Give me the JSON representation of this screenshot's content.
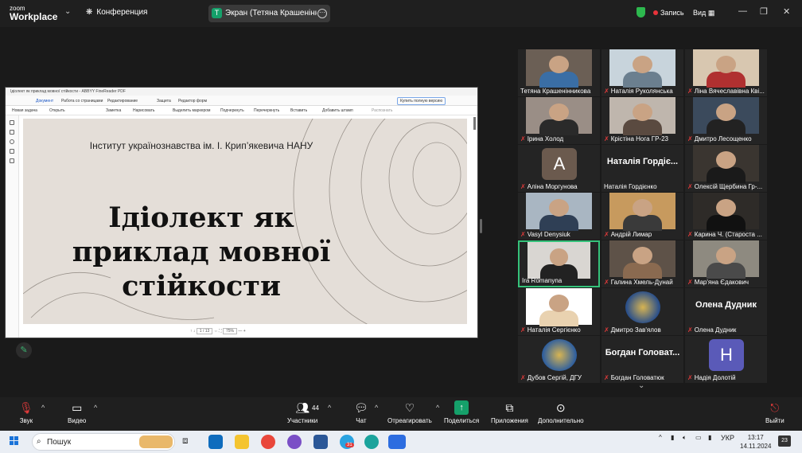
{
  "topbar": {
    "brand_small": "zoom",
    "brand_big": "Workplace",
    "conference": "Конференция",
    "share_initial": "T",
    "share_label": "Экран (Тетяна Крашенінникова",
    "record_label": "Запись",
    "view_label": "Вид"
  },
  "shared_window": {
    "title": "Ідіолект як приклад мовної стійкости - ABBYY FineReader PDF",
    "menu": [
      "Документ",
      "Работа со страницами",
      "Редактирование",
      "Защита",
      "Редактор форм"
    ],
    "buy_label": "Купить полную версию",
    "tools": [
      "Новая задача",
      "Открыть",
      "Заметка",
      "Нарисовать",
      "Выделить маркером",
      "Подчеркнуть",
      "Перечеркнуть",
      "Вставить",
      "Добавить штамп",
      "Распознать"
    ],
    "page_indicator": "1 / 13",
    "zoom": "75%"
  },
  "slide": {
    "institute": "Інститут українознавства ім. І. Крип’якевича НАНУ",
    "title_line1": "Ідіолект як",
    "title_line2": "приклад мовної",
    "title_line3": "стійкости"
  },
  "participants": [
    {
      "name": "Тетяна Крашенінникова",
      "muted": false,
      "kind": "photo",
      "bg": "#6b5f55",
      "shirt": "#3a6ea5"
    },
    {
      "name": "Наталія Руколянська",
      "muted": true,
      "kind": "photo",
      "bg": "#c8d4dc",
      "shirt": "#6b7f8f"
    },
    {
      "name": "Ліна Вячеславівна Кві...",
      "muted": true,
      "kind": "photo",
      "bg": "#d8c7b0",
      "shirt": "#b03030"
    },
    {
      "name": "Ірина Холод",
      "muted": true,
      "kind": "photo",
      "bg": "#9a8e86",
      "shirt": "#2a2a2a"
    },
    {
      "name": "Крістіна Нога ГР-23",
      "muted": true,
      "kind": "photo",
      "bg": "#bfb6ad",
      "shirt": "#5a4a40"
    },
    {
      "name": "Дмитро Лесощенко",
      "muted": true,
      "kind": "photo",
      "bg": "#3b4a5c",
      "shirt": "#222"
    },
    {
      "name": "Аліна Моргунова",
      "muted": true,
      "kind": "letter",
      "letter": "A",
      "color": "#6b5a4e"
    },
    {
      "name": "Наталія Гордієнко",
      "muted": false,
      "kind": "bigname",
      "big": "Наталія Гордіє..."
    },
    {
      "name": "Олексій Щербина Гр-...",
      "muted": true,
      "kind": "photo",
      "bg": "#3a3530",
      "shirt": "#1a1a1a"
    },
    {
      "name": "Vasyl Denysiuk",
      "muted": true,
      "kind": "photo",
      "bg": "#a9b6c2",
      "shirt": "#2f3f55"
    },
    {
      "name": "Андрій Лимар",
      "muted": true,
      "kind": "photo",
      "bg": "#c79a5e",
      "shirt": "#3a3a3a"
    },
    {
      "name": "Карина Ч. (Староста ...",
      "muted": true,
      "kind": "photo",
      "bg": "#2e2b28",
      "shirt": "#111"
    },
    {
      "name": "Ira Romanyna",
      "muted": false,
      "kind": "photo",
      "bg": "#d9d6d2",
      "shirt": "#222",
      "active": true
    },
    {
      "name": "Галина Хмель-Дунай",
      "muted": true,
      "kind": "photo",
      "bg": "#5e5248",
      "shirt": "#8a6a50"
    },
    {
      "name": "Мар'яна Єдакович",
      "muted": true,
      "kind": "photo",
      "bg": "#8e8a80",
      "shirt": "#4a4a4a"
    },
    {
      "name": "Наталія Сергієнко",
      "muted": true,
      "kind": "photo",
      "bg": "#ffffff",
      "shirt": "#e9d2b0"
    },
    {
      "name": "Дмитро Зав'ялов",
      "muted": true,
      "kind": "emblem",
      "color": "#2a4f8a"
    },
    {
      "name": "Олена Дудник",
      "muted": true,
      "kind": "bigname",
      "big": "Олена Дудник"
    },
    {
      "name": "Дубов Сергій, ДГУ",
      "muted": true,
      "kind": "emblem",
      "color": "#2f5f9e"
    },
    {
      "name": "Богдан Головатюк",
      "muted": true,
      "kind": "bigname",
      "big": "Богдан Головат..."
    },
    {
      "name": "Надія Долотій",
      "muted": true,
      "kind": "letter",
      "letter": "H",
      "color": "#5a5ab8"
    }
  ],
  "toolbar": {
    "sound": "Звук",
    "video": "Видео",
    "participants": "Участники",
    "participants_count": "44",
    "chat": "Чат",
    "react": "Отреагировать",
    "share": "Поделиться",
    "apps": "Приложения",
    "more": "Дополнительно",
    "leave": "Выйти"
  },
  "taskbar": {
    "search": "Пошук",
    "lang": "УКР",
    "time": "13:17",
    "date": "14.11.2024",
    "notifications": "23",
    "telegram_badge": "31"
  },
  "colors": {
    "accent_green": "#35c27a",
    "mute_red": "#e03a3a",
    "share_green": "#15a06a"
  }
}
